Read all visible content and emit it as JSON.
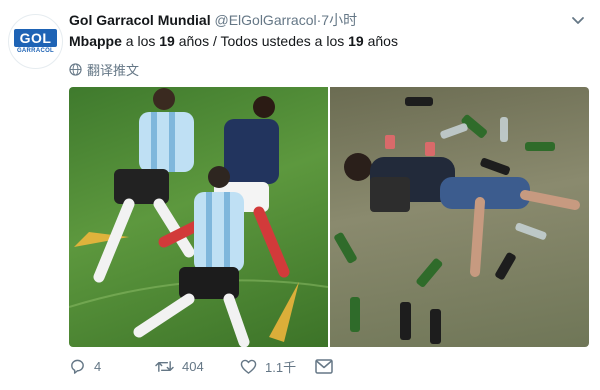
{
  "colors": {
    "brand": "#1e63b5",
    "muted": "#657786",
    "text": "#14171a"
  },
  "avatar": {
    "logo_main": "GOL",
    "logo_sub": "GARRACOL"
  },
  "header": {
    "name": "Gol Garracol Mundial",
    "handle": "@ElGolGarracol",
    "separator": "·",
    "time": "7小时"
  },
  "tweet": {
    "part1": "Mbappe",
    "part2": " a los ",
    "part3": "19",
    "part4": " años / Todos ustedes a los ",
    "part5": "19",
    "part6": " años"
  },
  "translate": {
    "label": "翻译推文",
    "icon": "globe-icon"
  },
  "media": {
    "left_image": "football-match-photo",
    "right_image": "passed-out-person-with-bottles-photo"
  },
  "actions": {
    "reply": {
      "icon": "reply-icon",
      "count": "4"
    },
    "retweet": {
      "icon": "retweet-icon",
      "count": "404"
    },
    "like": {
      "icon": "heart-icon",
      "count": "1.1千"
    },
    "dm": {
      "icon": "mail-icon"
    }
  }
}
